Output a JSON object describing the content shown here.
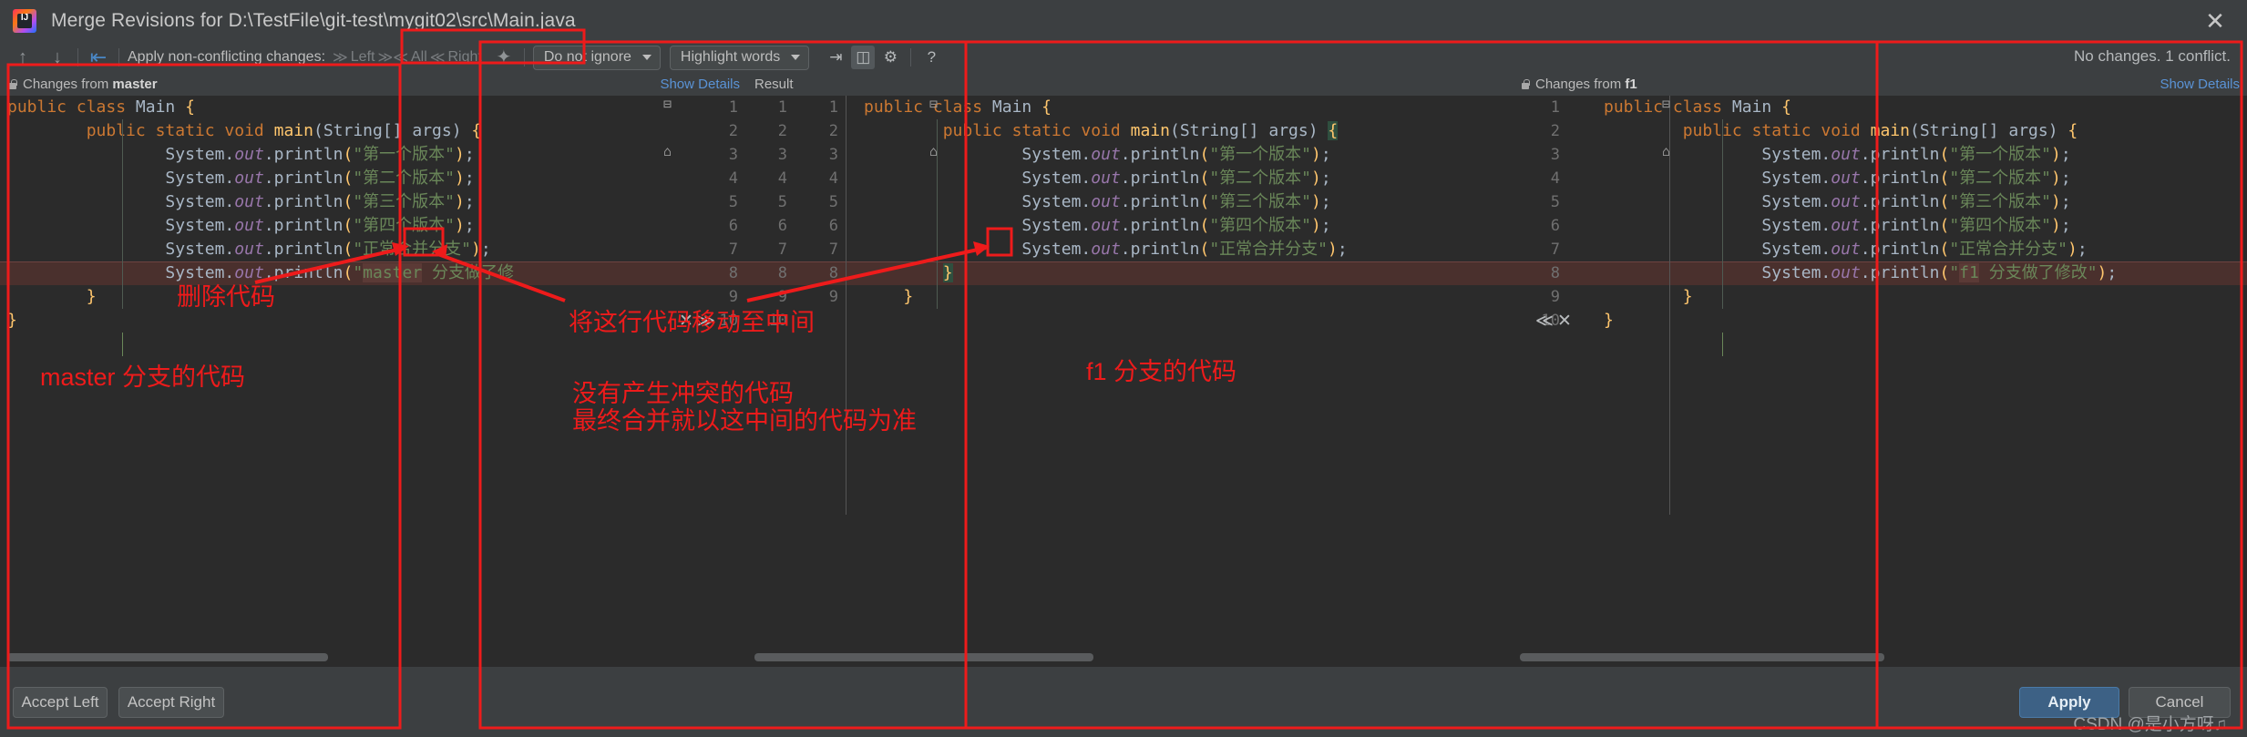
{
  "window": {
    "title": "Merge Revisions for D:\\TestFile\\git-test\\mygit02\\src\\Main.java",
    "logo_text": "IJ",
    "close_glyph": "✕"
  },
  "toolbar": {
    "prev_glyph": "↑",
    "next_glyph": "↓",
    "revert_glyph": "⇤",
    "apply_label": "Apply non-conflicting changes:",
    "apply_left": "Left",
    "apply_all": "All",
    "apply_right": "Right",
    "left_chevron": "≫",
    "all_chevron": "≫≪",
    "right_chevron": "≪",
    "magic_glyph": "✦",
    "ignore_combo": "Do not ignore",
    "highlight_combo": "Highlight words",
    "collapse_glyph": "⇥",
    "columns_glyph": "◫",
    "settings_glyph": "⚙",
    "help_glyph": "?",
    "status": "No changes. 1 conflict."
  },
  "panes": {
    "left": {
      "title_prefix": "Changes from ",
      "title_branch": "master",
      "show_details": "Show Details",
      "lines": [
        {
          "n": "1",
          "indent": 0,
          "tokens": [
            {
              "t": "public ",
              "c": "k"
            },
            {
              "t": "class ",
              "c": "k"
            },
            {
              "t": "Main",
              "c": "cls"
            },
            {
              "t": " {",
              "c": "br"
            }
          ]
        },
        {
          "n": "2",
          "indent": 2,
          "tokens": [
            {
              "t": "public ",
              "c": "k"
            },
            {
              "t": "static ",
              "c": "k"
            },
            {
              "t": "void ",
              "c": "k"
            },
            {
              "t": "main",
              "c": "br"
            },
            {
              "t": "(",
              "c": "id"
            },
            {
              "t": "String",
              "c": "cls"
            },
            {
              "t": "[] args",
              "c": "id"
            },
            {
              "t": ")",
              "c": "id"
            },
            {
              "t": " {",
              "c": "br"
            }
          ]
        },
        {
          "n": "3",
          "indent": 4,
          "tokens": [
            {
              "t": "System",
              "c": "id"
            },
            {
              "t": ".",
              "c": "id"
            },
            {
              "t": "out",
              "c": "fd"
            },
            {
              "t": ".println",
              "c": "id"
            },
            {
              "t": "(",
              "c": "q"
            },
            {
              "t": "\"第一个版本\"",
              "c": "st"
            },
            {
              "t": ")",
              "c": "q"
            },
            {
              "t": ";",
              "c": "id"
            }
          ]
        },
        {
          "n": "4",
          "indent": 4,
          "tokens": [
            {
              "t": "System",
              "c": "id"
            },
            {
              "t": ".",
              "c": "id"
            },
            {
              "t": "out",
              "c": "fd"
            },
            {
              "t": ".println",
              "c": "id"
            },
            {
              "t": "(",
              "c": "q"
            },
            {
              "t": "\"第二个版本\"",
              "c": "st"
            },
            {
              "t": ")",
              "c": "q"
            },
            {
              "t": ";",
              "c": "id"
            }
          ]
        },
        {
          "n": "5",
          "indent": 4,
          "tokens": [
            {
              "t": "System",
              "c": "id"
            },
            {
              "t": ".",
              "c": "id"
            },
            {
              "t": "out",
              "c": "fd"
            },
            {
              "t": ".println",
              "c": "id"
            },
            {
              "t": "(",
              "c": "q"
            },
            {
              "t": "\"第三个版本\"",
              "c": "st"
            },
            {
              "t": ")",
              "c": "q"
            },
            {
              "t": ";",
              "c": "id"
            }
          ]
        },
        {
          "n": "6",
          "indent": 4,
          "tokens": [
            {
              "t": "System",
              "c": "id"
            },
            {
              "t": ".",
              "c": "id"
            },
            {
              "t": "out",
              "c": "fd"
            },
            {
              "t": ".println",
              "c": "id"
            },
            {
              "t": "(",
              "c": "q"
            },
            {
              "t": "\"第四个版本\"",
              "c": "st"
            },
            {
              "t": ")",
              "c": "q"
            },
            {
              "t": ";",
              "c": "id"
            }
          ]
        },
        {
          "n": "7",
          "indent": 4,
          "tokens": [
            {
              "t": "System",
              "c": "id"
            },
            {
              "t": ".",
              "c": "id"
            },
            {
              "t": "out",
              "c": "fd"
            },
            {
              "t": ".println",
              "c": "id"
            },
            {
              "t": "(",
              "c": "q"
            },
            {
              "t": "\"正常合并分支\"",
              "c": "st"
            },
            {
              "t": ")",
              "c": "q"
            },
            {
              "t": ";",
              "c": "id"
            }
          ]
        },
        {
          "n": "8",
          "indent": 4,
          "conflict": true,
          "tokens": [
            {
              "t": "System",
              "c": "id"
            },
            {
              "t": ".",
              "c": "id"
            },
            {
              "t": "out",
              "c": "fd"
            },
            {
              "t": ".println",
              "c": "id"
            },
            {
              "t": "(",
              "c": "q"
            },
            {
              "t": "\"",
              "c": "st"
            },
            {
              "t": "master",
              "c": "st hl"
            },
            {
              "t": " 分支做了修",
              "c": "st"
            }
          ]
        },
        {
          "n": "9",
          "indent": 2,
          "tokens": [
            {
              "t": "}",
              "c": "br"
            }
          ]
        },
        {
          "n": "10",
          "indent": 0,
          "tokens": [
            {
              "t": "}",
              "c": "br"
            }
          ]
        }
      ],
      "conflict_actions": [
        "✕",
        "≫"
      ]
    },
    "middle": {
      "title": "Result",
      "lines": [
        {
          "n1": "1",
          "n2": "1",
          "indent": 0,
          "tokens": [
            {
              "t": "public ",
              "c": "k"
            },
            {
              "t": "class ",
              "c": "k"
            },
            {
              "t": "Main",
              "c": "cls"
            },
            {
              "t": " {",
              "c": "br"
            }
          ]
        },
        {
          "n1": "2",
          "n2": "2",
          "indent": 2,
          "tokens": [
            {
              "t": "public ",
              "c": "k"
            },
            {
              "t": "static ",
              "c": "k"
            },
            {
              "t": "void ",
              "c": "k"
            },
            {
              "t": "main",
              "c": "br"
            },
            {
              "t": "(",
              "c": "id"
            },
            {
              "t": "String",
              "c": "cls"
            },
            {
              "t": "[] args",
              "c": "id"
            },
            {
              "t": ")",
              "c": "id"
            },
            {
              "t": " ",
              "c": "id"
            },
            {
              "t": "{",
              "c": "br hl-green"
            }
          ]
        },
        {
          "n1": "3",
          "n2": "3",
          "indent": 4,
          "tokens": [
            {
              "t": "System",
              "c": "id"
            },
            {
              "t": ".",
              "c": "id"
            },
            {
              "t": "out",
              "c": "fd"
            },
            {
              "t": ".println",
              "c": "id"
            },
            {
              "t": "(",
              "c": "q"
            },
            {
              "t": "\"第一个版本\"",
              "c": "st"
            },
            {
              "t": ")",
              "c": "q"
            },
            {
              "t": ";",
              "c": "id"
            }
          ]
        },
        {
          "n1": "4",
          "n2": "4",
          "indent": 4,
          "tokens": [
            {
              "t": "System",
              "c": "id"
            },
            {
              "t": ".",
              "c": "id"
            },
            {
              "t": "out",
              "c": "fd"
            },
            {
              "t": ".println",
              "c": "id"
            },
            {
              "t": "(",
              "c": "q"
            },
            {
              "t": "\"第二个版本\"",
              "c": "st"
            },
            {
              "t": ")",
              "c": "q"
            },
            {
              "t": ";",
              "c": "id"
            }
          ]
        },
        {
          "n1": "5",
          "n2": "5",
          "indent": 4,
          "tokens": [
            {
              "t": "System",
              "c": "id"
            },
            {
              "t": ".",
              "c": "id"
            },
            {
              "t": "out",
              "c": "fd"
            },
            {
              "t": ".println",
              "c": "id"
            },
            {
              "t": "(",
              "c": "q"
            },
            {
              "t": "\"第三个版本\"",
              "c": "st"
            },
            {
              "t": ")",
              "c": "q"
            },
            {
              "t": ";",
              "c": "id"
            }
          ]
        },
        {
          "n1": "6",
          "n2": "6",
          "indent": 4,
          "tokens": [
            {
              "t": "System",
              "c": "id"
            },
            {
              "t": ".",
              "c": "id"
            },
            {
              "t": "out",
              "c": "fd"
            },
            {
              "t": ".println",
              "c": "id"
            },
            {
              "t": "(",
              "c": "q"
            },
            {
              "t": "\"第四个版本\"",
              "c": "st"
            },
            {
              "t": ")",
              "c": "q"
            },
            {
              "t": ";",
              "c": "id"
            }
          ]
        },
        {
          "n1": "7",
          "n2": "7",
          "indent": 4,
          "tokens": [
            {
              "t": "System",
              "c": "id"
            },
            {
              "t": ".",
              "c": "id"
            },
            {
              "t": "out",
              "c": "fd"
            },
            {
              "t": ".println",
              "c": "id"
            },
            {
              "t": "(",
              "c": "q"
            },
            {
              "t": "\"正常合并分支\"",
              "c": "st"
            },
            {
              "t": ")",
              "c": "q"
            },
            {
              "t": ";",
              "c": "id"
            }
          ]
        },
        {
          "n1": "8",
          "n2": "8",
          "indent": 2,
          "conflict": true,
          "tokens": [
            {
              "t": "}",
              "c": "br hl-green"
            }
          ]
        },
        {
          "n1": "9",
          "n2": "9",
          "indent": 1,
          "tokens": [
            {
              "t": "}",
              "c": "br"
            }
          ]
        },
        {
          "n1": "10",
          "n2": "",
          "indent": 0,
          "tokens": []
        }
      ]
    },
    "right": {
      "title_prefix": "Changes from ",
      "title_branch": "f1",
      "show_details": "Show Details",
      "lines": [
        {
          "n": "1",
          "indent": 0,
          "tokens": [
            {
              "t": "public ",
              "c": "k"
            },
            {
              "t": "class ",
              "c": "k"
            },
            {
              "t": "Main",
              "c": "cls"
            },
            {
              "t": " {",
              "c": "br"
            }
          ]
        },
        {
          "n": "2",
          "indent": 2,
          "tokens": [
            {
              "t": "public ",
              "c": "k"
            },
            {
              "t": "static ",
              "c": "k"
            },
            {
              "t": "void ",
              "c": "k"
            },
            {
              "t": "main",
              "c": "br"
            },
            {
              "t": "(",
              "c": "id"
            },
            {
              "t": "String",
              "c": "cls"
            },
            {
              "t": "[] args",
              "c": "id"
            },
            {
              "t": ")",
              "c": "id"
            },
            {
              "t": " {",
              "c": "br"
            }
          ]
        },
        {
          "n": "3",
          "indent": 4,
          "tokens": [
            {
              "t": "System",
              "c": "id"
            },
            {
              "t": ".",
              "c": "id"
            },
            {
              "t": "out",
              "c": "fd"
            },
            {
              "t": ".println",
              "c": "id"
            },
            {
              "t": "(",
              "c": "q"
            },
            {
              "t": "\"第一个版本\"",
              "c": "st"
            },
            {
              "t": ")",
              "c": "q"
            },
            {
              "t": ";",
              "c": "id"
            }
          ]
        },
        {
          "n": "4",
          "indent": 4,
          "tokens": [
            {
              "t": "System",
              "c": "id"
            },
            {
              "t": ".",
              "c": "id"
            },
            {
              "t": "out",
              "c": "fd"
            },
            {
              "t": ".println",
              "c": "id"
            },
            {
              "t": "(",
              "c": "q"
            },
            {
              "t": "\"第二个版本\"",
              "c": "st"
            },
            {
              "t": ")",
              "c": "q"
            },
            {
              "t": ";",
              "c": "id"
            }
          ]
        },
        {
          "n": "5",
          "indent": 4,
          "tokens": [
            {
              "t": "System",
              "c": "id"
            },
            {
              "t": ".",
              "c": "id"
            },
            {
              "t": "out",
              "c": "fd"
            },
            {
              "t": ".println",
              "c": "id"
            },
            {
              "t": "(",
              "c": "q"
            },
            {
              "t": "\"第三个版本\"",
              "c": "st"
            },
            {
              "t": ")",
              "c": "q"
            },
            {
              "t": ";",
              "c": "id"
            }
          ]
        },
        {
          "n": "6",
          "indent": 4,
          "tokens": [
            {
              "t": "System",
              "c": "id"
            },
            {
              "t": ".",
              "c": "id"
            },
            {
              "t": "out",
              "c": "fd"
            },
            {
              "t": ".println",
              "c": "id"
            },
            {
              "t": "(",
              "c": "q"
            },
            {
              "t": "\"第四个版本\"",
              "c": "st"
            },
            {
              "t": ")",
              "c": "q"
            },
            {
              "t": ";",
              "c": "id"
            }
          ]
        },
        {
          "n": "7",
          "indent": 4,
          "tokens": [
            {
              "t": "System",
              "c": "id"
            },
            {
              "t": ".",
              "c": "id"
            },
            {
              "t": "out",
              "c": "fd"
            },
            {
              "t": ".println",
              "c": "id"
            },
            {
              "t": "(",
              "c": "q"
            },
            {
              "t": "\"正常合并分支\"",
              "c": "st"
            },
            {
              "t": ")",
              "c": "q"
            },
            {
              "t": ";",
              "c": "id"
            }
          ]
        },
        {
          "n": "8",
          "indent": 4,
          "conflict": true,
          "tokens": [
            {
              "t": "System",
              "c": "id"
            },
            {
              "t": ".",
              "c": "id"
            },
            {
              "t": "out",
              "c": "fd"
            },
            {
              "t": ".println",
              "c": "id"
            },
            {
              "t": "(",
              "c": "q"
            },
            {
              "t": "\"",
              "c": "st"
            },
            {
              "t": "f1",
              "c": "st hl"
            },
            {
              "t": " 分支做了修改\"",
              "c": "st"
            },
            {
              "t": ")",
              "c": "q"
            },
            {
              "t": ";",
              "c": "id"
            }
          ]
        },
        {
          "n": "9",
          "indent": 2,
          "tokens": [
            {
              "t": "}",
              "c": "br"
            }
          ]
        },
        {
          "n": "10",
          "indent": 0,
          "tokens": [
            {
              "t": "}",
              "c": "br"
            }
          ]
        }
      ],
      "conflict_actions": [
        "≪",
        "✕"
      ]
    }
  },
  "bottom": {
    "accept_left": "Accept Left",
    "accept_right": "Accept Right",
    "apply": "Apply",
    "cancel": "Cancel",
    "watermark": "CSDN @是小方呀♫"
  },
  "annotations": {
    "delete_code": "删除代码",
    "move_line": "将这行代码移动至中间",
    "master_branch_code": "master 分支的代码",
    "f1_branch_code": "f1 分支的代码",
    "no_conflict_1": "没有产生冲突的代码",
    "no_conflict_2": "最终合并就以这中间的代码为准"
  },
  "colors": {
    "annotation_red": "#ee1b1b",
    "accent_blue": "#3d6185",
    "link_blue": "#5a93d6",
    "conflict_bg": "#4a302d"
  }
}
